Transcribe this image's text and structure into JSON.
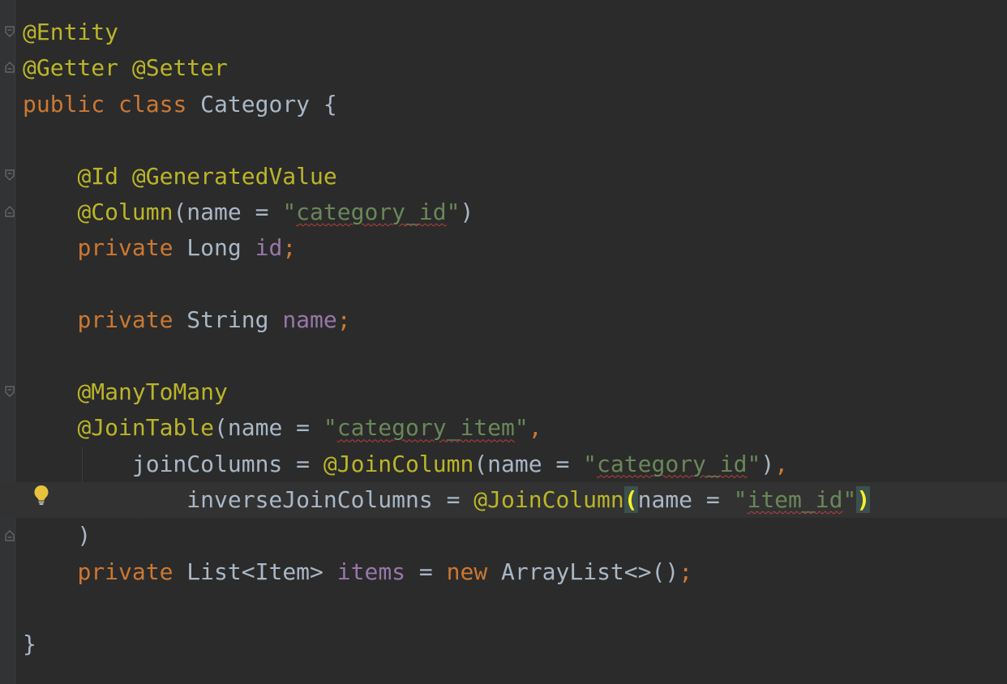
{
  "editor": {
    "colors": {
      "background": "#2b2b2b",
      "annotation": "#bbb529",
      "keyword": "#cc7832",
      "string": "#6a8759",
      "field": "#9876aa",
      "text": "#a9b7c6",
      "bulb": "#e8c23c"
    },
    "lines": [
      {
        "tokens": [
          {
            "t": "@Entity",
            "c": "ann"
          }
        ]
      },
      {
        "tokens": [
          {
            "t": "@Getter",
            "c": "ann"
          },
          {
            "t": " ",
            "c": "plain"
          },
          {
            "t": "@Setter",
            "c": "ann"
          }
        ]
      },
      {
        "tokens": [
          {
            "t": "public",
            "c": "kw"
          },
          {
            "t": " ",
            "c": "plain"
          },
          {
            "t": "class",
            "c": "kw"
          },
          {
            "t": " Category {",
            "c": "plain"
          }
        ]
      },
      {
        "tokens": []
      },
      {
        "tokens": [
          {
            "t": "    ",
            "c": "plain"
          },
          {
            "t": "@Id",
            "c": "ann"
          },
          {
            "t": " ",
            "c": "plain"
          },
          {
            "t": "@GeneratedValue",
            "c": "ann"
          }
        ]
      },
      {
        "tokens": [
          {
            "t": "    ",
            "c": "plain"
          },
          {
            "t": "@Column",
            "c": "ann"
          },
          {
            "t": "(name = ",
            "c": "plain"
          },
          {
            "t": "\"",
            "c": "str"
          },
          {
            "t": "category_id",
            "c": "str typo"
          },
          {
            "t": "\"",
            "c": "str"
          },
          {
            "t": ")",
            "c": "plain"
          }
        ]
      },
      {
        "tokens": [
          {
            "t": "    ",
            "c": "plain"
          },
          {
            "t": "private",
            "c": "kw"
          },
          {
            "t": " Long ",
            "c": "plain"
          },
          {
            "t": "id",
            "c": "field"
          },
          {
            "t": ";",
            "c": "kw"
          }
        ]
      },
      {
        "tokens": []
      },
      {
        "tokens": [
          {
            "t": "    ",
            "c": "plain"
          },
          {
            "t": "private",
            "c": "kw"
          },
          {
            "t": " String ",
            "c": "plain"
          },
          {
            "t": "name",
            "c": "field"
          },
          {
            "t": ";",
            "c": "kw"
          }
        ]
      },
      {
        "tokens": []
      },
      {
        "tokens": [
          {
            "t": "    ",
            "c": "plain"
          },
          {
            "t": "@ManyToMany",
            "c": "ann"
          }
        ]
      },
      {
        "tokens": [
          {
            "t": "    ",
            "c": "plain"
          },
          {
            "t": "@JoinTable",
            "c": "ann"
          },
          {
            "t": "(name = ",
            "c": "plain"
          },
          {
            "t": "\"",
            "c": "str"
          },
          {
            "t": "category_item",
            "c": "str typo"
          },
          {
            "t": "\"",
            "c": "str"
          },
          {
            "t": ",",
            "c": "kw"
          }
        ]
      },
      {
        "tokens": [
          {
            "t": "        joinColumns = ",
            "c": "plain"
          },
          {
            "t": "@JoinColumn",
            "c": "ann"
          },
          {
            "t": "(name = ",
            "c": "plain"
          },
          {
            "t": "\"",
            "c": "str"
          },
          {
            "t": "category_id",
            "c": "str typo"
          },
          {
            "t": "\"",
            "c": "str"
          },
          {
            "t": ")",
            "c": "plain"
          },
          {
            "t": ",",
            "c": "kw"
          }
        ]
      },
      {
        "current": true,
        "tokens": [
          {
            "t": "            inverseJoinColumns = ",
            "c": "plain"
          },
          {
            "t": "@JoinColumn",
            "c": "ann"
          },
          {
            "t": "(",
            "c": "paren-match"
          },
          {
            "t": "name = ",
            "c": "plain"
          },
          {
            "t": "\"",
            "c": "str"
          },
          {
            "t": "item_id",
            "c": "str typo"
          },
          {
            "t": "\"",
            "c": "str"
          },
          {
            "t": ")",
            "c": "paren-match"
          }
        ]
      },
      {
        "tokens": [
          {
            "t": "    )",
            "c": "plain"
          }
        ]
      },
      {
        "tokens": [
          {
            "t": "    ",
            "c": "plain"
          },
          {
            "t": "private",
            "c": "kw"
          },
          {
            "t": " List<Item> ",
            "c": "plain"
          },
          {
            "t": "items",
            "c": "field"
          },
          {
            "t": " = ",
            "c": "plain"
          },
          {
            "t": "new",
            "c": "kw"
          },
          {
            "t": " ArrayList<>()",
            "c": "plain"
          },
          {
            "t": ";",
            "c": "kw"
          }
        ]
      },
      {
        "tokens": []
      },
      {
        "tokens": [
          {
            "t": "}",
            "c": "plain"
          }
        ]
      }
    ],
    "icons": {
      "intention": "lightbulb-icon",
      "fold": "fold-marker-icon"
    }
  }
}
